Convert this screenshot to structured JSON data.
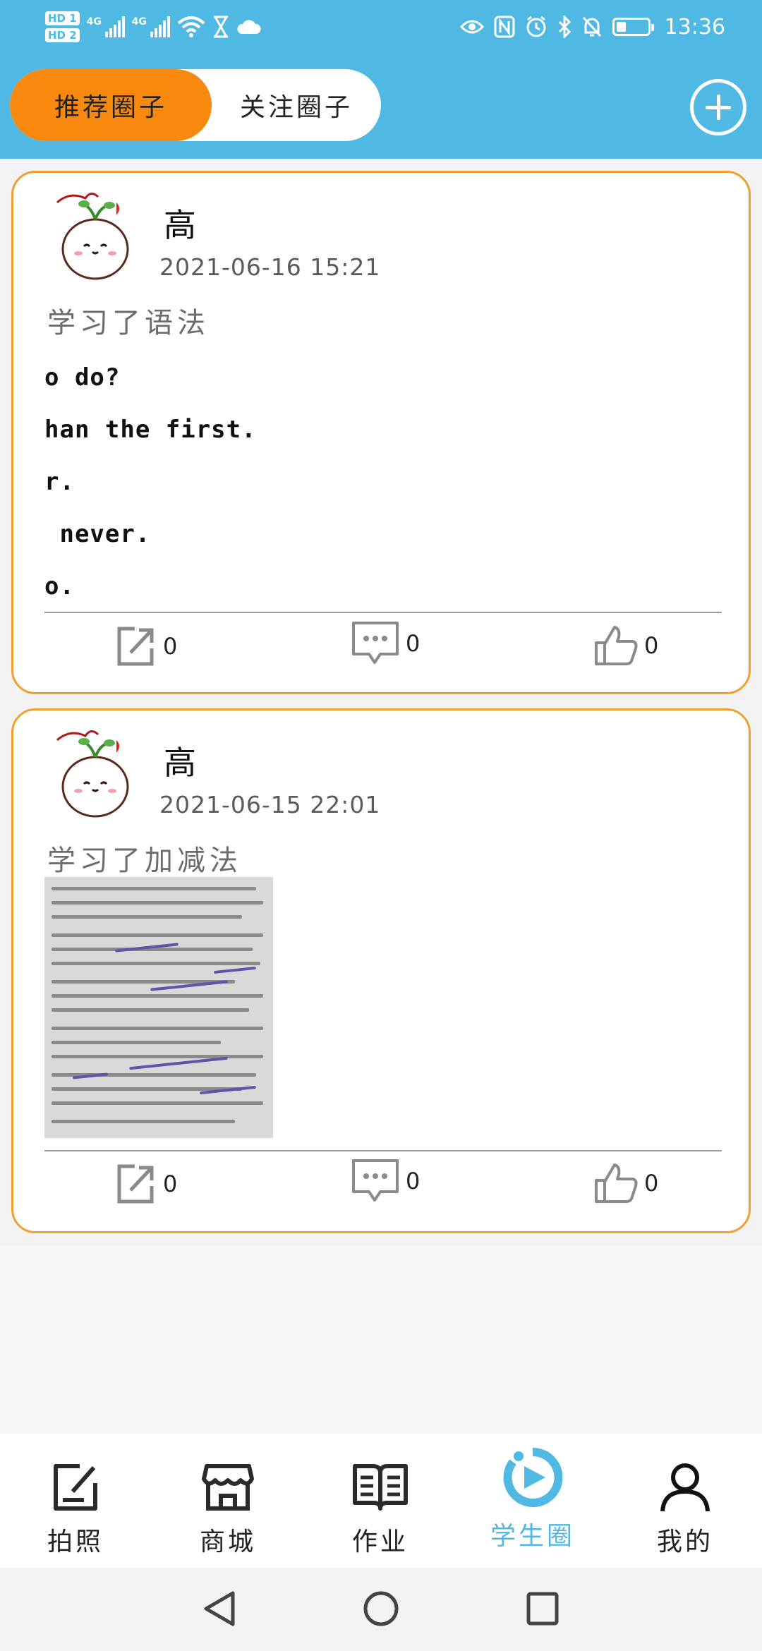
{
  "status_bar": {
    "hd_badges": [
      "HD 1",
      "HD 2"
    ],
    "network": [
      "4G",
      "4G"
    ],
    "time": "13:36",
    "battery_level": 0.3,
    "icons": [
      "wifi-icon",
      "hourglass-icon",
      "cloud-icon",
      "eye-icon",
      "nfc-icon",
      "alarm-icon",
      "bluetooth-icon",
      "mute-icon",
      "battery-icon"
    ]
  },
  "header": {
    "tabs": [
      {
        "label": "推荐圈子",
        "active": true
      },
      {
        "label": "关注圈子",
        "active": false
      }
    ],
    "add_icon": "add-circle-icon"
  },
  "posts": [
    {
      "author": "高",
      "timestamp": "2021-06-16  15:21",
      "text": "学习了语法",
      "photo_lines": [
        "o do?",
        "han the first.",
        "r.",
        " never.",
        "o."
      ],
      "share_count": "0",
      "comment_count": "0",
      "like_count": "0"
    },
    {
      "author": "高",
      "timestamp": "2021-06-15  22:01",
      "text": "学习了加减法",
      "share_count": "0",
      "comment_count": "0",
      "like_count": "0"
    }
  ],
  "bottom_nav": [
    {
      "label": "拍照",
      "icon": "edit-icon",
      "active": false
    },
    {
      "label": "商城",
      "icon": "store-icon",
      "active": false
    },
    {
      "label": "作业",
      "icon": "book-icon",
      "active": false
    },
    {
      "label": "学生圈",
      "icon": "circle-play-icon",
      "active": true
    },
    {
      "label": "我的",
      "icon": "user-icon",
      "active": false
    }
  ],
  "system_nav": [
    "back",
    "home",
    "recents"
  ],
  "colors": {
    "header_bg": "#4fb9e3",
    "active_tab": "#f8890e",
    "card_border": "#f0a030",
    "active_nav": "#4fb9e3"
  }
}
